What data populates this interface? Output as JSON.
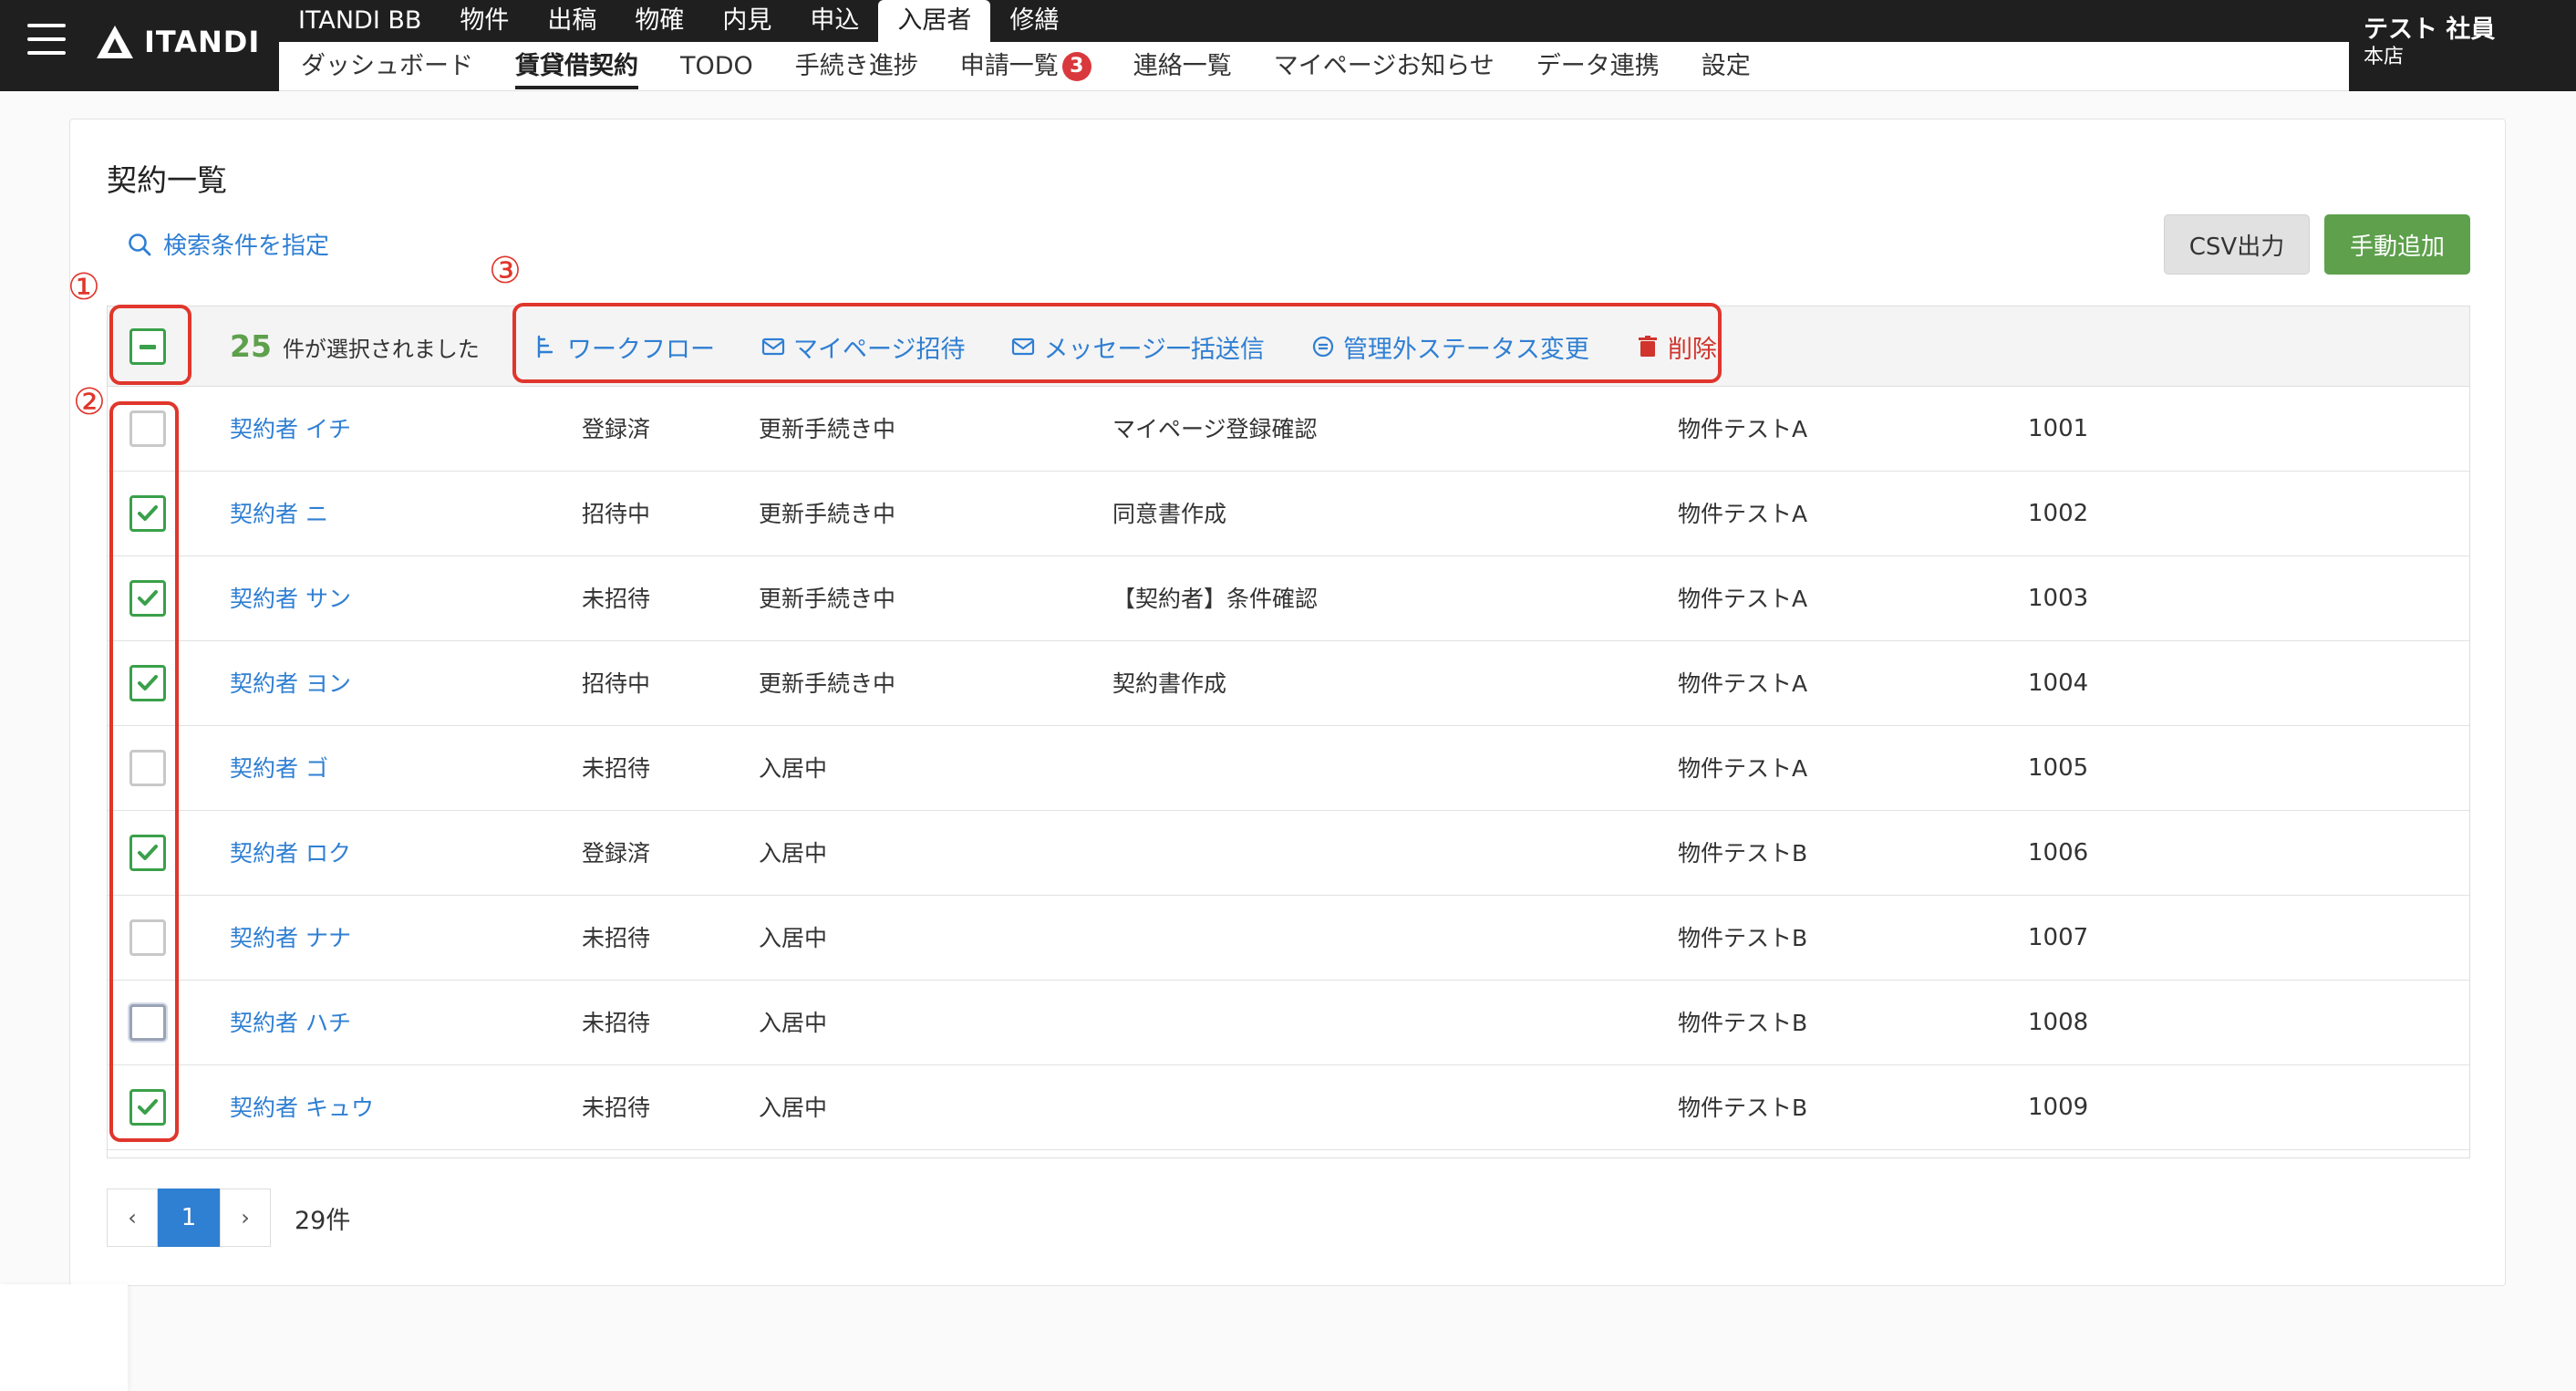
{
  "header": {
    "logo_text": "ITANDI",
    "top_tabs": [
      "ITANDI BB",
      "物件",
      "出稿",
      "物確",
      "内見",
      "申込",
      "入居者",
      "修繕"
    ],
    "active_top_tab": 6,
    "sub_nav": [
      {
        "label": "ダッシュボード"
      },
      {
        "label": "賃貸借契約"
      },
      {
        "label": "TODO"
      },
      {
        "label": "手続き進捗"
      },
      {
        "label": "申請一覧",
        "badge": "3"
      },
      {
        "label": "連絡一覧"
      },
      {
        "label": "マイページお知らせ"
      },
      {
        "label": "データ連携"
      },
      {
        "label": "設定"
      }
    ],
    "active_sub_nav": 1,
    "user": {
      "name": "テスト 社員",
      "branch": "本店"
    }
  },
  "main": {
    "title": "契約一覧",
    "search_label": "検索条件を指定",
    "csv_button": "CSV出力",
    "add_button": "手動追加",
    "selection": {
      "count": "25",
      "text": "件が選択されました"
    },
    "bulk_actions": [
      {
        "label": "ワークフロー",
        "icon": "workflow-icon"
      },
      {
        "label": "マイページ招待",
        "icon": "envelope-icon"
      },
      {
        "label": "メッセージ一括送信",
        "icon": "envelope-icon"
      },
      {
        "label": "管理外ステータス変更",
        "icon": "status-icon"
      },
      {
        "label": "削除",
        "icon": "trash-icon"
      }
    ],
    "rows": [
      {
        "name": "契約者 イチ",
        "invite": "登録済",
        "status": "更新手続き中",
        "task": "マイページ登録確認",
        "property": "物件テストA",
        "room": "1001",
        "checked": false
      },
      {
        "name": "契約者 ニ",
        "invite": "招待中",
        "status": "更新手続き中",
        "task": "同意書作成",
        "property": "物件テストA",
        "room": "1002",
        "checked": true
      },
      {
        "name": "契約者 サン",
        "invite": "未招待",
        "status": "更新手続き中",
        "task": "【契約者】条件確認",
        "property": "物件テストA",
        "room": "1003",
        "checked": true
      },
      {
        "name": "契約者 ヨン",
        "invite": "招待中",
        "status": "更新手続き中",
        "task": "契約書作成",
        "property": "物件テストA",
        "room": "1004",
        "checked": true
      },
      {
        "name": "契約者 ゴ",
        "invite": "未招待",
        "status": "入居中",
        "task": "",
        "property": "物件テストA",
        "room": "1005",
        "checked": false
      },
      {
        "name": "契約者 ロク",
        "invite": "登録済",
        "status": "入居中",
        "task": "",
        "property": "物件テストB",
        "room": "1006",
        "checked": true
      },
      {
        "name": "契約者 ナナ",
        "invite": "未招待",
        "status": "入居中",
        "task": "",
        "property": "物件テストB",
        "room": "1007",
        "checked": false
      },
      {
        "name": "契約者 ハチ",
        "invite": "未招待",
        "status": "入居中",
        "task": "",
        "property": "物件テストB",
        "room": "1008",
        "checked": false,
        "focused": true
      },
      {
        "name": "契約者 キュウ",
        "invite": "未招待",
        "status": "入居中",
        "task": "",
        "property": "物件テストB",
        "room": "1009",
        "checked": true
      }
    ],
    "pagination": {
      "prev": "‹",
      "current": "1",
      "next": "›",
      "total": "29件"
    }
  },
  "annotations": [
    "①",
    "②",
    "③"
  ],
  "colors": {
    "accent_blue": "#2f7fd3",
    "accent_green": "#5ea04c",
    "danger": "#d0342c",
    "annotation_red": "#e0362c",
    "header_bg": "#1f1f1f"
  }
}
